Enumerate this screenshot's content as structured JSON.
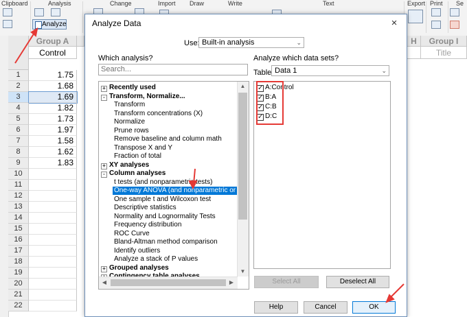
{
  "ribbon": {
    "groups": [
      "Clipboard",
      "Analysis",
      "Change",
      "Import",
      "Draw",
      "Write",
      "Text",
      "Export",
      "Print",
      "Se"
    ],
    "analyze_label": "Analyze"
  },
  "sheet": {
    "columns": [
      {
        "letter": "Group A",
        "title": "Control"
      },
      {
        "letter": "H",
        "title": ""
      },
      {
        "letter": "Group I",
        "title": "Title"
      }
    ],
    "rows": [
      "1",
      "2",
      "3",
      "4",
      "5",
      "6",
      "7",
      "8",
      "9",
      "10",
      "11",
      "12",
      "13",
      "14",
      "15",
      "16",
      "17",
      "18",
      "19",
      "20",
      "21",
      "22"
    ],
    "values": [
      "1.75",
      "1.68",
      "1.69",
      "1.82",
      "1.73",
      "1.97",
      "1.58",
      "1.62",
      "1.83"
    ]
  },
  "dialog": {
    "title": "Analyze Data",
    "close": "×",
    "use_label": "Use:",
    "use_value": "Built-in analysis",
    "which_label": "Which analysis?",
    "search_placeholder": "Search...",
    "tree": [
      {
        "label": "Recently used",
        "kind": "group",
        "exp": "+"
      },
      {
        "label": "Transform, Normalize...",
        "kind": "group",
        "exp": "-"
      },
      {
        "label": "Transform",
        "kind": "item"
      },
      {
        "label": "Transform concentrations (X)",
        "kind": "item"
      },
      {
        "label": "Normalize",
        "kind": "item"
      },
      {
        "label": "Prune rows",
        "kind": "item"
      },
      {
        "label": "Remove baseline and column math",
        "kind": "item"
      },
      {
        "label": "Transpose X and Y",
        "kind": "item"
      },
      {
        "label": "Fraction of total",
        "kind": "item"
      },
      {
        "label": "XY analyses",
        "kind": "group",
        "exp": "+"
      },
      {
        "label": "Column analyses",
        "kind": "group",
        "exp": "-"
      },
      {
        "label": "t tests (and nonparametric tests)",
        "kind": "item"
      },
      {
        "label": "One-way ANOVA (and nonparametric or mi",
        "kind": "item",
        "selected": true
      },
      {
        "label": "One sample t and Wilcoxon test",
        "kind": "item"
      },
      {
        "label": "Descriptive statistics",
        "kind": "item"
      },
      {
        "label": "Normality and Lognormality Tests",
        "kind": "item"
      },
      {
        "label": "Frequency distribution",
        "kind": "item"
      },
      {
        "label": "ROC Curve",
        "kind": "item"
      },
      {
        "label": "Bland-Altman method comparison",
        "kind": "item"
      },
      {
        "label": "Identify outliers",
        "kind": "item"
      },
      {
        "label": "Analyze a stack of P values",
        "kind": "item"
      },
      {
        "label": "Grouped analyses",
        "kind": "group",
        "exp": "+"
      },
      {
        "label": "Contingency table analyses",
        "kind": "group",
        "exp": "+"
      }
    ],
    "datasets_label": "Analyze which data sets?",
    "table_label": "Table:",
    "table_value": "Data 1",
    "datasets": [
      {
        "label": "A:Control",
        "checked": true
      },
      {
        "label": "B:A",
        "checked": true
      },
      {
        "label": "C:B",
        "checked": true
      },
      {
        "label": "D:C",
        "checked": true
      }
    ],
    "select_all": "Select All",
    "deselect_all": "Deselect All",
    "help": "Help",
    "cancel": "Cancel",
    "ok": "OK"
  },
  "colors": {
    "accent": "#0078d7",
    "annotation": "#e53935"
  }
}
